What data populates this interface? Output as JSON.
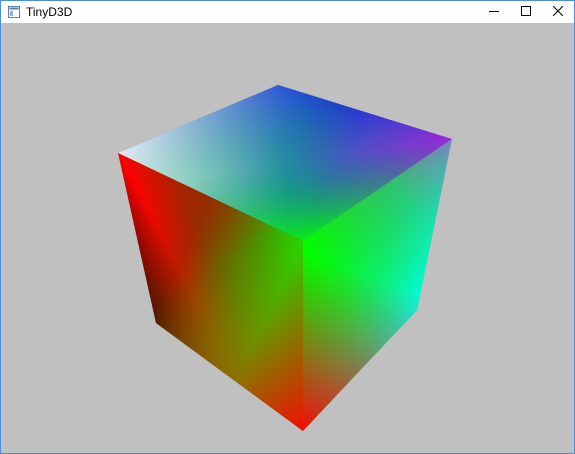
{
  "window": {
    "title": "TinyD3D",
    "icon": "app-window-icon",
    "controls": {
      "minimize_icon": "minimize-icon",
      "maximize_icon": "maximize-icon",
      "close_icon": "close-icon"
    }
  },
  "viewport": {
    "background_color": "#c0c0c0",
    "scene": "rgb-color-cube",
    "vertex_colors": {
      "black": "#000000",
      "red": "#ff0000",
      "green": "#00ff00",
      "blue": "#0000ff",
      "magenta": "#ff00ff",
      "cyan": "#00ffff",
      "white": "#ffffff",
      "yellow": "#ffff00"
    }
  }
}
